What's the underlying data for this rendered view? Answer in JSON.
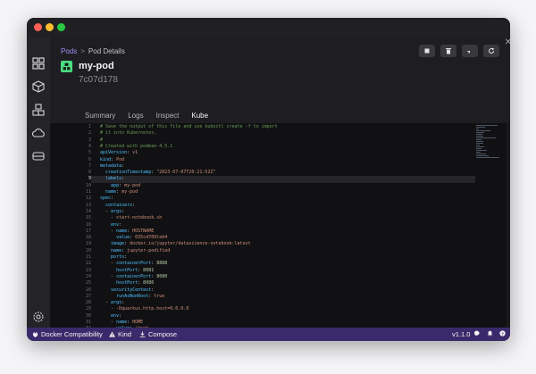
{
  "breadcrumb": {
    "root": "Pods",
    "separator": ">",
    "current": "Pod Details"
  },
  "pod": {
    "name": "my-pod",
    "id": "7c07d178"
  },
  "tabs": [
    {
      "label": "Summary",
      "active": false
    },
    {
      "label": "Logs",
      "active": false
    },
    {
      "label": "Inspect",
      "active": false
    },
    {
      "label": "Kube",
      "active": true
    }
  ],
  "actions": [
    "stop-icon",
    "trash-icon",
    "rocket-icon",
    "refresh-icon"
  ],
  "editor": {
    "current_line": 9,
    "lines": [
      "# Save the output of this file and use kubectl create -f to import",
      "# it into Kubernetes.",
      "#",
      "# Created with podman-4.5.1",
      "apiVersion: v1",
      "kind: Pod",
      "metadata:",
      "  creationTimestamp: \"2023-07-07T20:21:52Z\"",
      "  labels:",
      "    app: my-pod",
      "  name: my-pod",
      "spec:",
      "  containers:",
      "  - args:",
      "    - start-notebook.sh",
      "    env:",
      "    - name: HOSTNAME",
      "      value: 035cd709leb4",
      "    image: docker.io/jupyter/datascience-notebook:latest",
      "    name: jupyter-podified",
      "    ports:",
      "    - containerPort: 8888",
      "      hostPort: 8081",
      "    - containerPort: 8080",
      "      hostPort: 8080",
      "    securityContext:",
      "      runAsNonRoot: true",
      "  - args:",
      "    - -Dquarkus.http.host=0.0.0.0",
      "    env:",
      "    - name: HOME",
      "      value: /root"
    ]
  },
  "statusbar": {
    "left": [
      {
        "icon": "plug-icon",
        "label": "Docker Compatibility"
      },
      {
        "icon": "warning-icon",
        "label": "Kind"
      },
      {
        "icon": "download-icon",
        "label": "Compose"
      }
    ],
    "version": "v1.1.0"
  },
  "colors": {
    "accent": "#a78bfa",
    "statusbar": "#3b2a6b",
    "pod_icon": "#4ade80"
  }
}
